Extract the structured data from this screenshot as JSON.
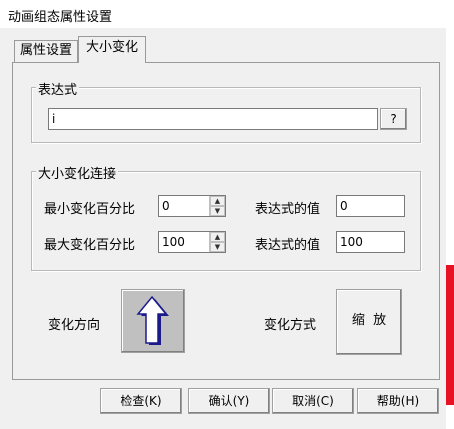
{
  "window": {
    "title": "动画组态属性设置"
  },
  "tabs": [
    {
      "label": "属性设置",
      "active": false
    },
    {
      "label": "大小变化",
      "active": true
    }
  ],
  "expression_group": {
    "legend": "表达式",
    "value": "i",
    "browse_label": "?"
  },
  "connection_group": {
    "legend": "大小变化连接",
    "min_percent_label": "最小变化百分比",
    "min_percent_value": "0",
    "min_expr_label": "表达式的值",
    "min_expr_value": "0",
    "max_percent_label": "最大变化百分比",
    "max_percent_value": "100",
    "max_expr_label": "表达式的值",
    "max_expr_value": "100"
  },
  "direction": {
    "label": "变化方向"
  },
  "mode": {
    "label": "变化方式",
    "button_label": "缩  放"
  },
  "buttons": {
    "check": "检查(K)",
    "confirm": "确认(Y)",
    "cancel": "取消(C)",
    "help": "帮助(H)"
  },
  "colors": {
    "dialog_bg": "#f0f0f0",
    "arrow_fill": "#ffffff",
    "arrow_shadow": "#1a1a8c",
    "direction_button_bg": "#c0c0c0"
  }
}
